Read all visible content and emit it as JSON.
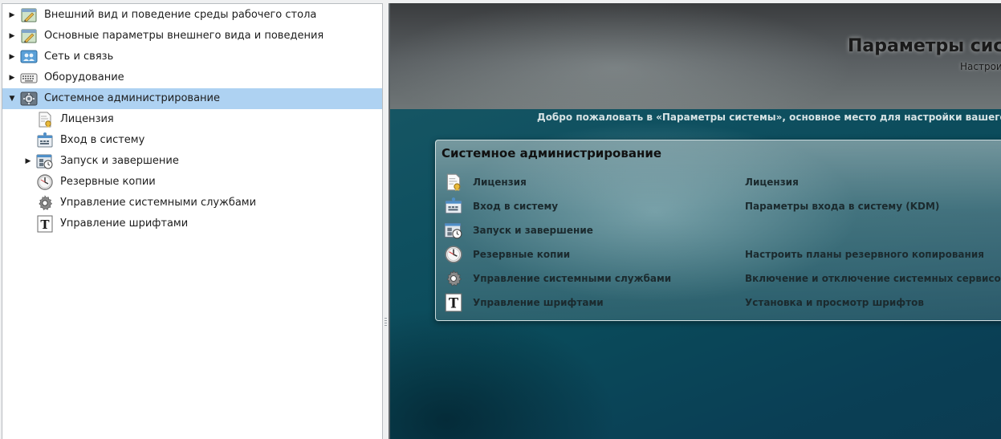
{
  "tree": {
    "items": [
      {
        "label": "Внешний вид и поведение среды рабочего стола",
        "icon": "appearance-icon",
        "expanded": false
      },
      {
        "label": "Основные параметры внешнего вида и поведения",
        "icon": "appearance-icon",
        "expanded": false
      },
      {
        "label": "Сеть и связь",
        "icon": "network-icon",
        "expanded": false
      },
      {
        "label": "Оборудование",
        "icon": "keyboard-icon",
        "expanded": false
      },
      {
        "label": "Системное администрирование",
        "icon": "system-admin-icon",
        "expanded": true,
        "selected": true
      }
    ],
    "children": [
      {
        "label": "Лицензия",
        "icon": "license-icon"
      },
      {
        "label": "Вход в систему",
        "icon": "login-icon"
      },
      {
        "label": "Запуск и завершение",
        "icon": "startup-icon",
        "has_children": true
      },
      {
        "label": "Резервные копии",
        "icon": "backup-clock-icon"
      },
      {
        "label": "Управление системными службами",
        "icon": "services-gear-icon"
      },
      {
        "label": "Управление шрифтами",
        "icon": "font-icon"
      }
    ]
  },
  "content": {
    "header_title": "Параметры сист",
    "header_subtitle": "Настрои",
    "welcome": "Добро пожаловать в «Параметры системы», основное место для настройки вашего компьюте",
    "section_title": "Системное администрирование",
    "modules": [
      {
        "name": "Лицензия",
        "desc": "Лицензия",
        "icon": "license-icon"
      },
      {
        "name": "Вход в систему",
        "desc": "Параметры входа в систему (KDM)",
        "icon": "login-icon"
      },
      {
        "name": "Запуск и завершение",
        "desc": "",
        "icon": "startup-icon"
      },
      {
        "name": "Резервные копии",
        "desc": "Настроить планы резервного копирования",
        "icon": "backup-clock-icon"
      },
      {
        "name": "Управление системными службами",
        "desc": "Включение и отключение системных сервисов",
        "icon": "services-gear-icon"
      },
      {
        "name": "Управление шрифтами",
        "desc": "Установка и просмотр шрифтов",
        "icon": "font-icon"
      }
    ]
  },
  "colors": {
    "selection": "#aed2f2",
    "content_bg": "#0f5060",
    "header_bg": "#5a5f62"
  }
}
